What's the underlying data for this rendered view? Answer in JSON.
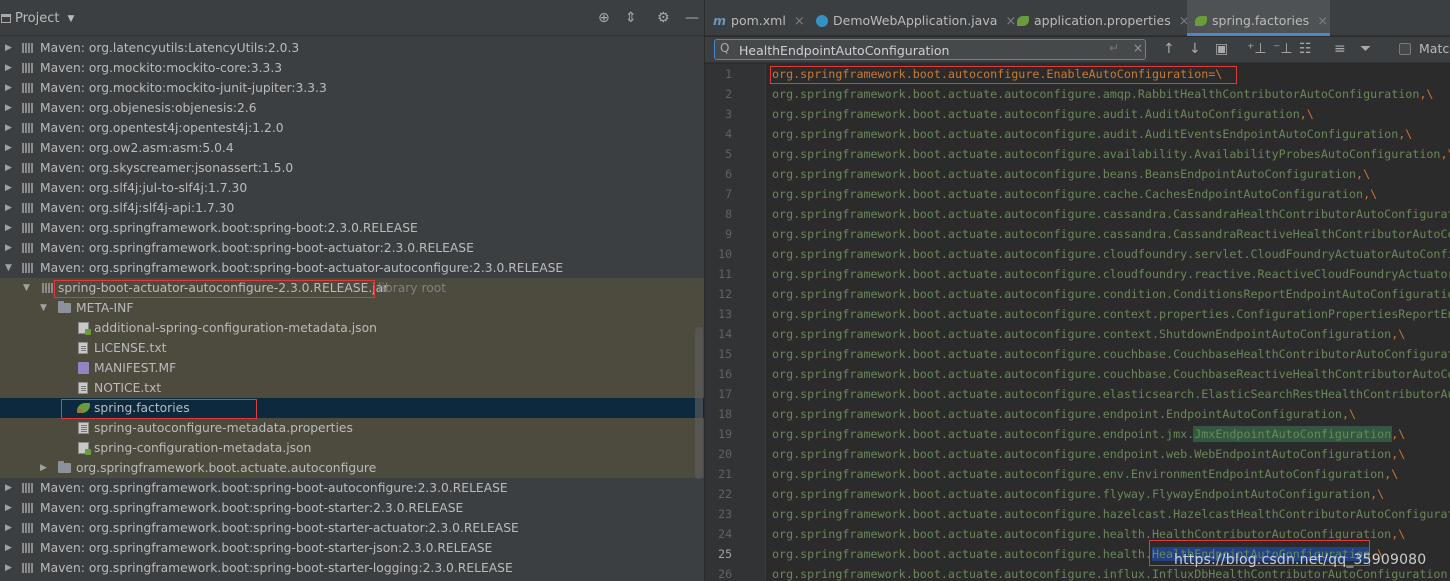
{
  "project_panel": {
    "title": "Project",
    "rows": [
      {
        "label": "Maven: org.latencyutils:LatencyUtils:2.0.3"
      },
      {
        "label": "Maven: org.mockito:mockito-core:3.3.3"
      },
      {
        "label": "Maven: org.mockito:mockito-junit-jupiter:3.3.3"
      },
      {
        "label": "Maven: org.objenesis:objenesis:2.6"
      },
      {
        "label": "Maven: org.opentest4j:opentest4j:1.2.0"
      },
      {
        "label": "Maven: org.ow2.asm:asm:5.0.4"
      },
      {
        "label": "Maven: org.skyscreamer:jsonassert:1.5.0"
      },
      {
        "label": "Maven: org.slf4j:jul-to-slf4j:1.7.30"
      },
      {
        "label": "Maven: org.slf4j:slf4j-api:1.7.30"
      },
      {
        "label": "Maven: org.springframework.boot:spring-boot:2.3.0.RELEASE"
      },
      {
        "label": "Maven: org.springframework.boot:spring-boot-actuator:2.3.0.RELEASE"
      },
      {
        "label": "Maven: org.springframework.boot:spring-boot-actuator-autoconfigure:2.3.0.RELEASE"
      },
      {
        "label": "spring-boot-actuator-autoconfigure-2.3.0.RELEASE.jar",
        "suffix": "library root"
      },
      {
        "label": "META-INF"
      },
      {
        "label": "additional-spring-configuration-metadata.json"
      },
      {
        "label": "LICENSE.txt"
      },
      {
        "label": "MANIFEST.MF"
      },
      {
        "label": "NOTICE.txt"
      },
      {
        "label": "spring.factories"
      },
      {
        "label": "spring-autoconfigure-metadata.properties"
      },
      {
        "label": "spring-configuration-metadata.json"
      },
      {
        "label": "org.springframework.boot.actuate.autoconfigure"
      },
      {
        "label": "Maven: org.springframework.boot:spring-boot-autoconfigure:2.3.0.RELEASE"
      },
      {
        "label": "Maven: org.springframework.boot:spring-boot-starter:2.3.0.RELEASE"
      },
      {
        "label": "Maven: org.springframework.boot:spring-boot-starter-actuator:2.3.0.RELEASE"
      },
      {
        "label": "Maven: org.springframework.boot:spring-boot-starter-json:2.3.0.RELEASE"
      },
      {
        "label": "Maven: org.springframework.boot:spring-boot-starter-logging:2.3.0.RELEASE"
      }
    ]
  },
  "tabs": [
    {
      "label": "pom.xml",
      "glyph": "m"
    },
    {
      "label": "DemoWebApplication.java"
    },
    {
      "label": "application.properties"
    },
    {
      "label": "spring.factories"
    }
  ],
  "find": {
    "query": "HealthEndpointAutoConfiguration",
    "match_label": "Match"
  },
  "code": {
    "prefix": "org.springframework.boot.actuate.autoconfigure.",
    "line1": "org.springframework.boot.autoconfigure.EnableAutoConfiguration=\\",
    "lines": [
      "amqp.RabbitHealthContributorAutoConfiguration,\\",
      "audit.AuditAutoConfiguration,\\",
      "audit.AuditEventsEndpointAutoConfiguration,\\",
      "availability.AvailabilityProbesAutoConfiguration,\\",
      "beans.BeansEndpointAutoConfiguration,\\",
      "cache.CachesEndpointAutoConfiguration,\\",
      "cassandra.CassandraHealthContributorAutoConfiguration,\\",
      "cassandra.CassandraReactiveHealthContributorAutoConfiguration,\\",
      "cloudfoundry.servlet.CloudFoundryActuatorAutoConfiguration,\\",
      "cloudfoundry.reactive.ReactiveCloudFoundryActuatorAutoConfiguration,\\",
      "condition.ConditionsReportEndpointAutoConfiguration,\\",
      "context.properties.ConfigurationPropertiesReportEndpointAutoConfiguration,\\",
      "context.ShutdownEndpointAutoConfiguration,\\",
      "couchbase.CouchbaseHealthContributorAutoConfiguration,\\",
      "couchbase.CouchbaseReactiveHealthContributorAutoConfiguration,\\",
      "elasticsearch.ElasticSearchRestHealthContributorAutoConfiguration,\\",
      "endpoint.EndpointAutoConfiguration,\\",
      "endpoint.jmx.|JmxEndpointAutoConfiguration|,\\",
      "endpoint.web.WebEndpointAutoConfiguration,\\",
      "env.EnvironmentEndpointAutoConfiguration,\\",
      "flyway.FlywayEndpointAutoConfiguration,\\",
      "hazelcast.HazelcastHealthContributorAutoConfiguration,\\",
      "health.HealthContributorAutoConfiguration,\\",
      "health.#HealthEndpointAutoConfiguration#,\\",
      "influx.InfluxDbHealthContributorAutoConfiguration,\\"
    ]
  },
  "watermark": "https://blog.csdn.net/qq_35909080"
}
